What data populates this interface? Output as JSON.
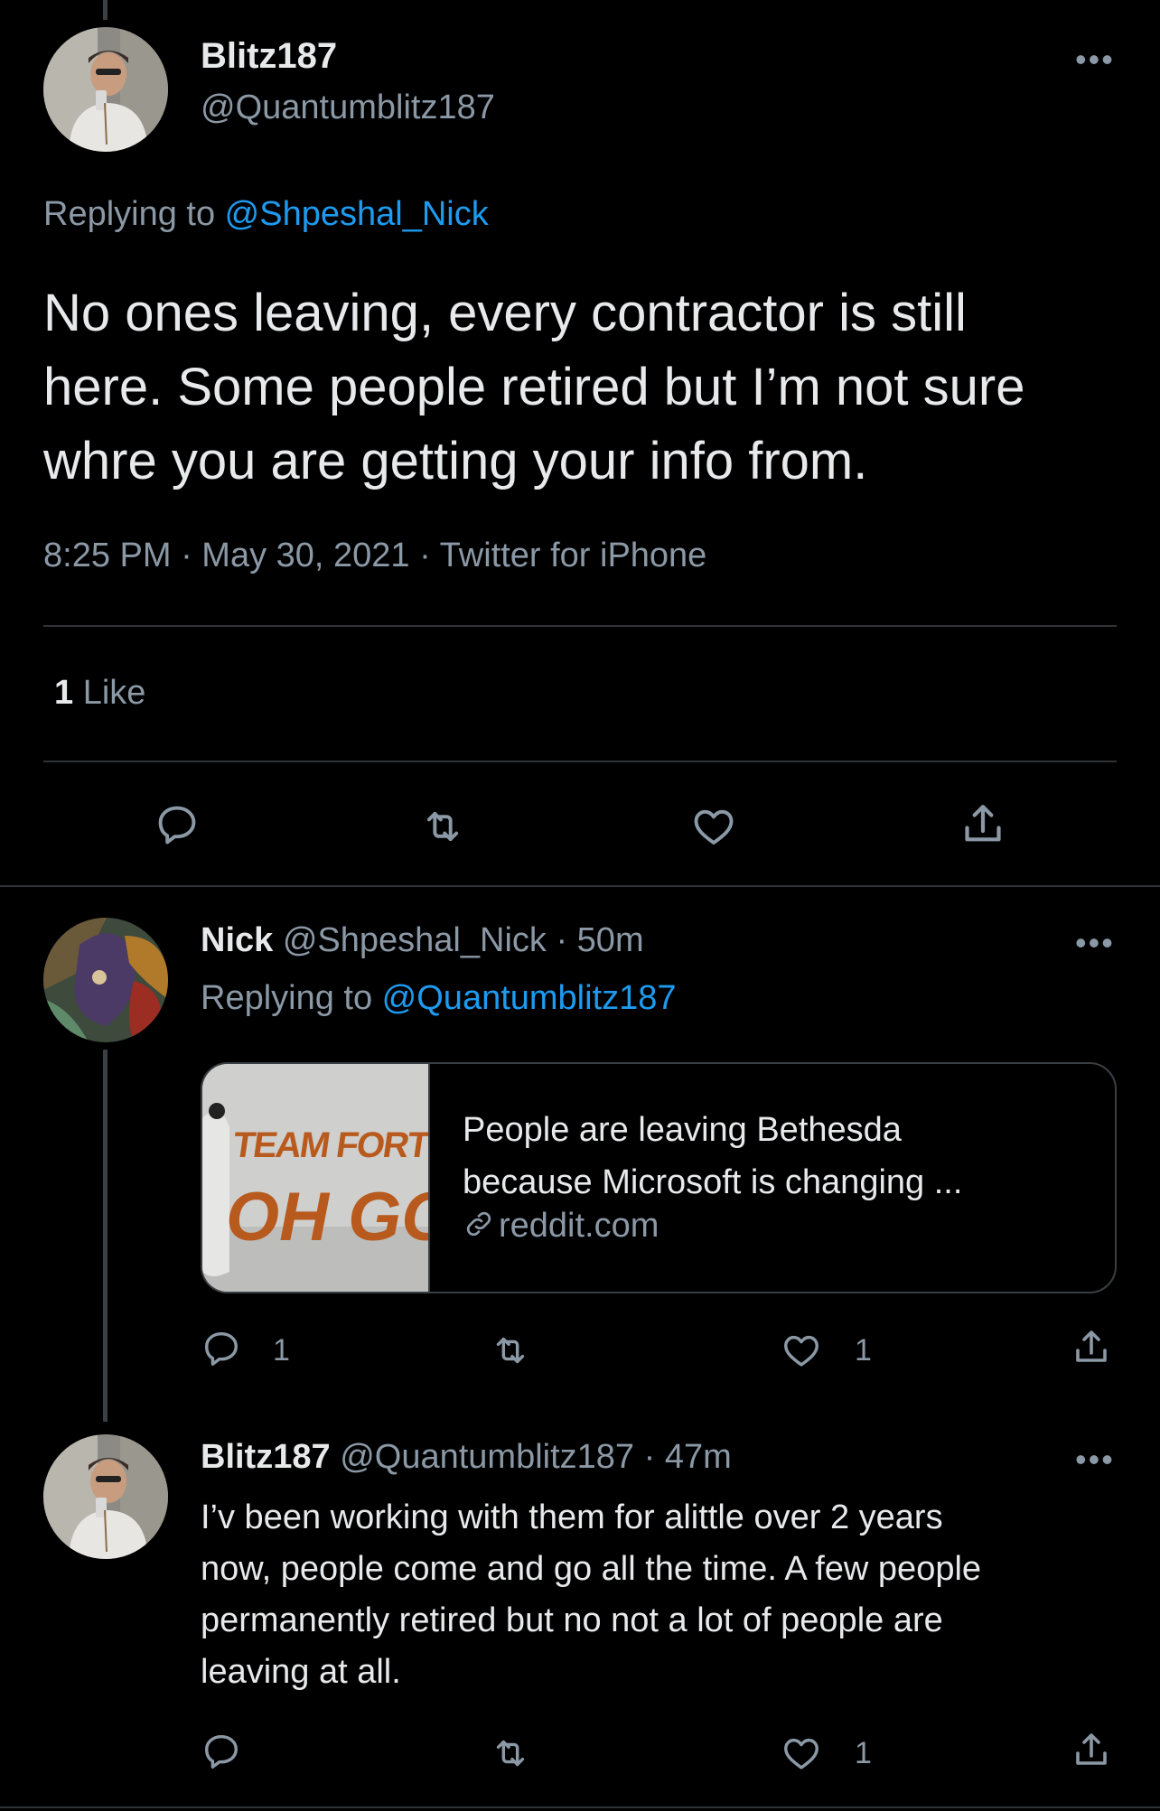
{
  "main_tweet": {
    "display_name": "Blitz187",
    "handle": "@Quantumblitz187",
    "replying_prefix": "Replying to ",
    "replying_to": "@Shpeshal_Nick",
    "text_lines": [
      "No ones leaving, every contractor is still",
      "here. Some people retired but I’m not sure",
      "whre you are getting your info from."
    ],
    "meta": "8:25 PM · May 30, 2021 · Twitter for iPhone",
    "like_count": "1",
    "like_label": " Like",
    "more_glyph": "•••"
  },
  "reply_1": {
    "display_name": "Nick",
    "handle": "@Shpeshal_Nick",
    "time": " · 50m",
    "replying_prefix": "Replying to ",
    "replying_to": "@Quantumblitz187",
    "card": {
      "thumb_text_top": "TEAM FORTRE",
      "thumb_text_big": "OH GO",
      "title_line1": "People are leaving Bethesda",
      "title_line2": "because Microsoft is changing ...",
      "domain": "reddit.com"
    },
    "reply_count": "1",
    "like_count": "1",
    "more_glyph": "•••"
  },
  "reply_2": {
    "display_name": "Blitz187",
    "handle": "@Quantumblitz187",
    "time": " · 47m",
    "text_lines": [
      "I’v been working with them for alittle over 2 years",
      "now, people come and go all the time. A few people",
      "permanently retired but no not a lot of people are",
      "leaving at all."
    ],
    "like_count": "1",
    "more_glyph": "•••"
  },
  "colors": {
    "background": "#000000",
    "text": "#e7e9ea",
    "muted": "#8b98a5",
    "link": "#1d9bf0",
    "divider": "#2f3336"
  },
  "icons": [
    "reply-icon",
    "retweet-icon",
    "like-icon",
    "share-icon",
    "link-icon",
    "more-icon"
  ]
}
